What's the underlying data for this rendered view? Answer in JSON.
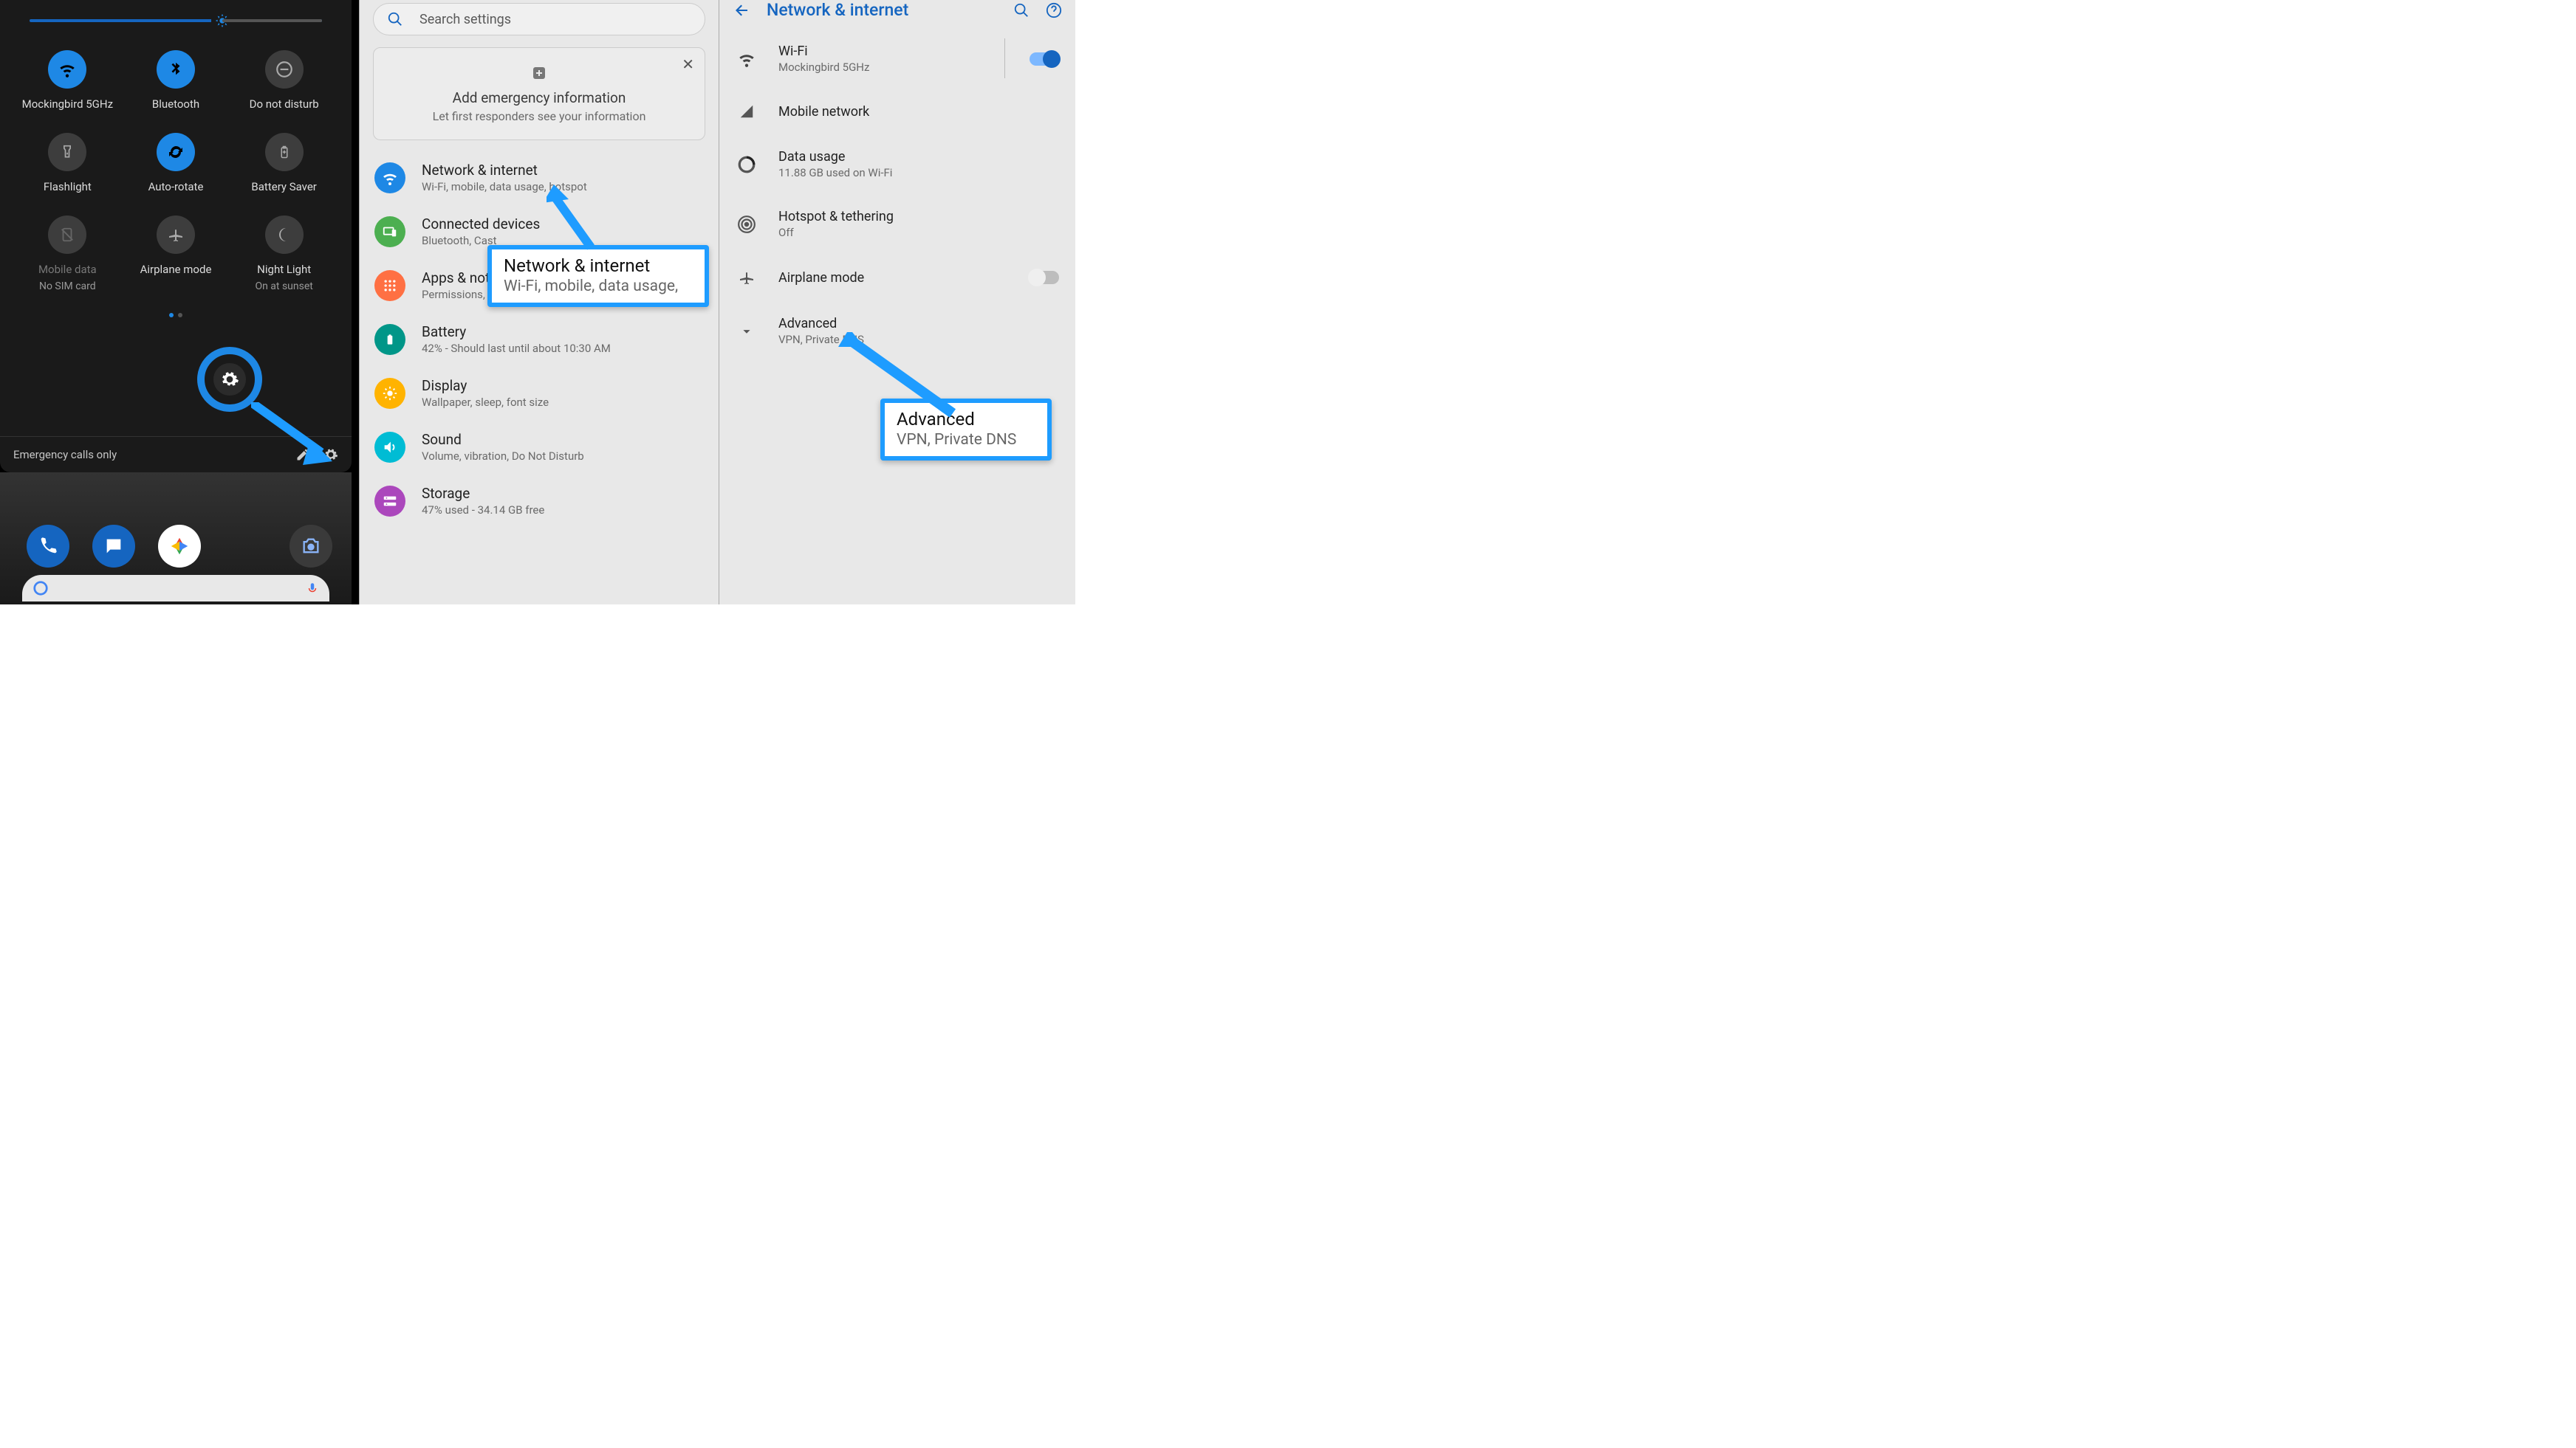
{
  "quicksettings": {
    "tiles": [
      {
        "label": "Mockingbird 5GHz",
        "on": true,
        "icon": "wifi"
      },
      {
        "label": "Bluetooth",
        "on": true,
        "icon": "bluetooth"
      },
      {
        "label": "Do not disturb",
        "on": false,
        "icon": "dnd"
      },
      {
        "label": "Flashlight",
        "on": false,
        "icon": "flashlight"
      },
      {
        "label": "Auto-rotate",
        "on": true,
        "icon": "rotate"
      },
      {
        "label": "Battery Saver",
        "on": false,
        "icon": "battery"
      },
      {
        "label": "Mobile data",
        "sub": "No SIM card",
        "on": false,
        "icon": "sim",
        "dim": true
      },
      {
        "label": "Airplane mode",
        "on": false,
        "icon": "airplane"
      },
      {
        "label": "Night Light",
        "sub": "On at sunset",
        "on": false,
        "icon": "moon"
      }
    ],
    "footer_status": "Emergency calls only"
  },
  "settings": {
    "search_placeholder": "Search settings",
    "emergency": {
      "title": "Add emergency information",
      "subtitle": "Let first responders see your information"
    },
    "items": [
      {
        "title": "Network & internet",
        "subtitle": "Wi-Fi, mobile, data usage, hotspot",
        "color": "#1e88e5",
        "icon": "wifi"
      },
      {
        "title": "Connected devices",
        "subtitle": "Bluetooth, Cast",
        "color": "#4caf50",
        "icon": "devices"
      },
      {
        "title": "Apps & notifications",
        "subtitle": "Permissions, default apps",
        "color": "#ff7043",
        "icon": "apps"
      },
      {
        "title": "Battery",
        "subtitle": "42% - Should last until about 10:30 AM",
        "color": "#009688",
        "icon": "battery"
      },
      {
        "title": "Display",
        "subtitle": "Wallpaper, sleep, font size",
        "color": "#ffb300",
        "icon": "display"
      },
      {
        "title": "Sound",
        "subtitle": "Volume, vibration, Do Not Disturb",
        "color": "#00bcd4",
        "icon": "sound"
      },
      {
        "title": "Storage",
        "subtitle": "47% used - 34.14 GB free",
        "color": "#ab47bc",
        "icon": "storage"
      }
    ],
    "callout": {
      "title": "Network & internet",
      "subtitle": "Wi-Fi, mobile, data usage,"
    }
  },
  "network": {
    "page_title": "Network & internet",
    "items": [
      {
        "title": "Wi-Fi",
        "subtitle": "Mockingbird 5GHz",
        "icon": "wifi",
        "toggle": "on"
      },
      {
        "title": "Mobile network",
        "icon": "signal"
      },
      {
        "title": "Data usage",
        "subtitle": "11.88 GB used on Wi-Fi",
        "icon": "datausage"
      },
      {
        "title": "Hotspot & tethering",
        "subtitle": "Off",
        "icon": "hotspot"
      },
      {
        "title": "Airplane mode",
        "icon": "airplane",
        "toggle": "off"
      },
      {
        "title": "Advanced",
        "subtitle": "VPN, Private DNS",
        "icon": "expand"
      }
    ],
    "callout": {
      "title": "Advanced",
      "subtitle": "VPN, Private DNS"
    }
  },
  "colors": {
    "accent": "#1e88e5",
    "callout": "#1e9cff"
  }
}
